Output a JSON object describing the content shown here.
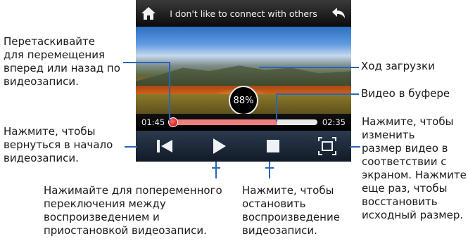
{
  "player": {
    "title": "I don't like to connect with others",
    "download_progress_text": "88%",
    "time_elapsed": "01:45",
    "time_total": "02:35",
    "buffer_fraction": 0.73,
    "position_fraction": 0.0,
    "icons": {
      "home": "home-icon",
      "back": "back-arrow-icon",
      "prev": "skip-to-start-icon",
      "play": "play-icon",
      "stop": "stop-icon",
      "resize": "fit-screen-icon"
    },
    "colors": {
      "buffer": "#f08080",
      "knob": "#d01818",
      "leader": "#2a64b8"
    }
  },
  "callouts": {
    "drag": "Перетаскивайте\nдля перемещения\nвперед или назад по\nвидеозаписи.",
    "download_progress": "Ход загрузки",
    "buffered": "Видео в буфере",
    "rewind": "Нажмите, чтобы\nвернуться в начало\nвидеозаписи.",
    "play_pause": "Нажимайте для попеременного\nпереключения между\nвоспроизведением и\nприостановкой видеозаписи.",
    "stop": "Нажмите, чтобы\nостановить\nвоспроизведение\nвидеозаписи.",
    "resize": "Нажмите, чтобы\nизменить\nразмер видео в\nсоответствии с\nэкраном. Нажмите\nеще раз, чтобы\nвосстановить\nисходный размер."
  }
}
